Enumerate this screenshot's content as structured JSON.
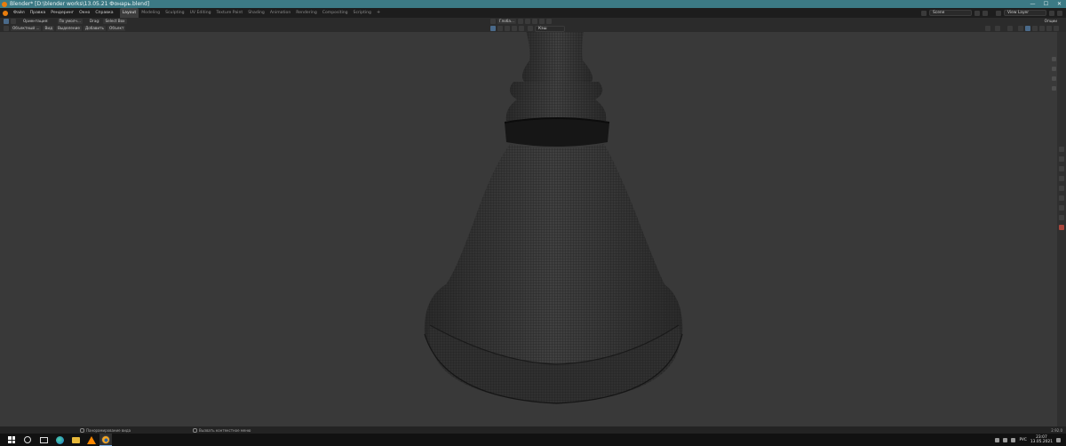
{
  "window": {
    "title": "Blender* [D:\\blender works\\13.05.21 Фонарь.blend]",
    "controls": {
      "minimize": "—",
      "maximize": "☐",
      "close": "✕"
    }
  },
  "menu": {
    "items": [
      "Файл",
      "Правка",
      "Рендеринг",
      "Окно",
      "Справка"
    ]
  },
  "workspaces": {
    "tabs": [
      "Layout",
      "Modeling",
      "Sculpting",
      "UV Editing",
      "Texture Paint",
      "Shading",
      "Animation",
      "Rendering",
      "Compositing",
      "Scripting"
    ],
    "active_index": 0,
    "add_label": "+"
  },
  "scene": {
    "scene_name": "Scene",
    "view_layer": "View Layer"
  },
  "header_row1": {
    "orientation_label": "Ориентация:",
    "orientation_value": "По умолч...",
    "drag_label": "Drag:",
    "drag_value": "Select Box",
    "global_label": "Глоба...",
    "options_label": "Опции"
  },
  "header_row2": {
    "mode_label": "Объектный ...",
    "view_label": "Вид",
    "select_label": "Выделение",
    "add_label": "Добавить",
    "object_label": "Объект",
    "search_value": "Кэш"
  },
  "statusbar": {
    "pan_hint": "Панорамирование вида",
    "context_hint": "Вызвать контекстное меню",
    "version": "2.92.0"
  },
  "taskbar": {
    "language": "РУС",
    "time": "23:07",
    "date": "13.05.2021"
  }
}
